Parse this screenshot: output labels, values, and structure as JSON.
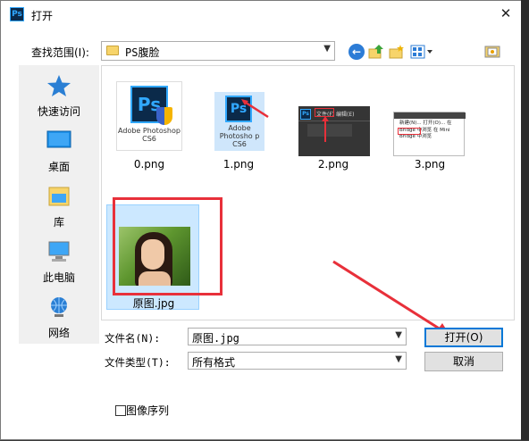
{
  "window": {
    "app_icon_text": "Ps",
    "title": "打开",
    "close_glyph": "✕"
  },
  "toolbar": {
    "lookin_label": "查找范围(I):",
    "lookin_value": "PS腹脸",
    "icons": [
      "back-arrow-icon",
      "up-folder-icon",
      "new-folder-icon",
      "view-menu-icon",
      "preview-pane-icon"
    ]
  },
  "places": [
    {
      "label": "快速访问",
      "icon": "star-icon"
    },
    {
      "label": "桌面",
      "icon": "desktop-icon"
    },
    {
      "label": "库",
      "icon": "library-icon"
    },
    {
      "label": "此电脑",
      "icon": "computer-icon"
    },
    {
      "label": "网络",
      "icon": "network-icon"
    }
  ],
  "files": [
    {
      "name": "0.png",
      "thumb_text": "Adobe Photoshop CS6"
    },
    {
      "name": "1.png",
      "thumb_text": "Adobe Photosho p CS6"
    },
    {
      "name": "2.png",
      "thumb_text": "文件(F) 编辑(E)"
    },
    {
      "name": "3.png",
      "thumb_text": "新建(N)... 打开(O)... 在 Bridge 中浏览 在 Mini Bridge 中浏览"
    },
    {
      "name": "原图.jpg",
      "selected": true
    }
  ],
  "form": {
    "filename_label": "文件名(N):",
    "filename_value": "原图.jpg",
    "filetype_label": "文件类型(T):",
    "filetype_value": "所有格式",
    "open_button": "打开(O)",
    "cancel_button": "取消",
    "sequence_checkbox": "图像序列",
    "sequence_checked": false
  },
  "colors": {
    "accent": "#0078d7",
    "annotation_red": "#e8303a",
    "selection": "#cce8ff"
  }
}
